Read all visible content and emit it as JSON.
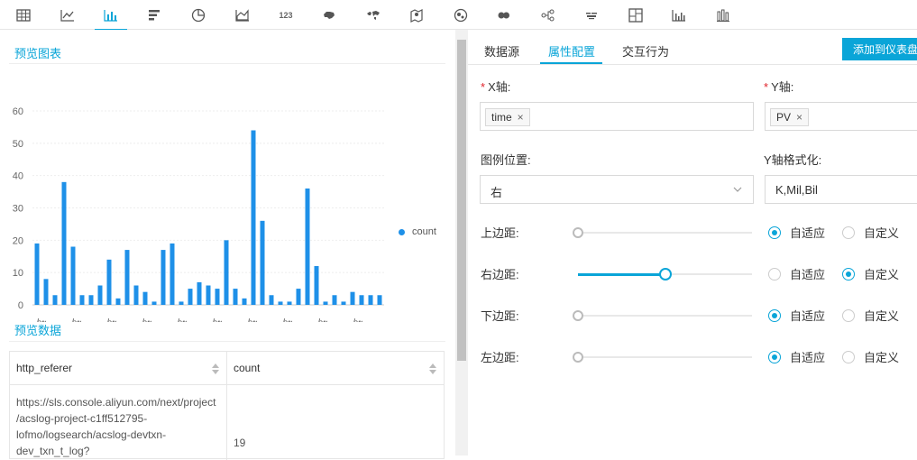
{
  "toolbar": {
    "icons": [
      "table-icon",
      "line-chart-icon",
      "bar-chart-icon",
      "horizontal-bar-icon",
      "pie-chart-icon",
      "area-chart-icon",
      "number-icon",
      "china-map-icon",
      "world-map-icon",
      "map-pin-icon",
      "flow-chart-icon",
      "scatter-map-icon",
      "tree-icon",
      "word-cloud-icon",
      "treemap-icon",
      "column-chart-icon",
      "stacked-bar-icon"
    ],
    "number_label": "123",
    "active_index": 2,
    "accent": "#0aa5d8"
  },
  "preview_chart": {
    "title": "预览图表",
    "legend": "count"
  },
  "chart_data": {
    "type": "bar",
    "categories": [
      "https...t884f",
      "https..duct=..39183",
      "https..duct=..4dakz",
      "https...logs",
      "https...s-app",
      "https...ce%22",
      "https...nq1rr",
      "https...12652",
      "https...duct=..nship",
      "https...scan"
    ],
    "values": [
      19,
      8,
      3,
      38,
      18,
      3,
      3,
      6,
      14,
      2,
      17,
      6,
      4,
      1,
      17,
      19,
      1,
      5,
      7,
      6,
      5,
      20,
      5,
      2,
      54,
      26,
      3,
      1,
      1,
      5,
      36,
      12,
      1,
      3,
      1,
      4,
      3,
      3,
      3
    ],
    "series": [
      {
        "name": "count"
      }
    ],
    "xlabel": "",
    "ylabel": "",
    "ylim": [
      0,
      60
    ],
    "yticks": [
      "0",
      "10",
      "20",
      "30",
      "40",
      "50",
      "60"
    ],
    "grid": true,
    "legend_position": "right",
    "bar_color": "#1e90e8"
  },
  "preview_data": {
    "title": "预览数据",
    "columns": [
      "http_referer",
      "count"
    ],
    "row": {
      "referer": [
        "https://sls.console.aliyun.com/next/project",
        "/acslog-project-c1ff512795-",
        "lofmo/logsearch/acslog-devtxn-",
        "dev_txn_t_log?"
      ],
      "count": "19"
    }
  },
  "config": {
    "tabs": [
      "数据源",
      "属性配置",
      "交互行为"
    ],
    "active_tab": 1,
    "add_button": "添加到仪表盘",
    "x_axis_label": "X轴:",
    "x_axis_tag": "time",
    "y_axis_label": "Y轴:",
    "y_axis_tag": "PV",
    "required_mark": "*",
    "tag_close": "×",
    "legend_pos_label": "图例位置:",
    "legend_pos_value": "右",
    "y_format_label": "Y轴格式化:",
    "y_format_value": "K,Mil,Bil",
    "margins": [
      {
        "label": "上边距:",
        "mode": "auto",
        "value": 0
      },
      {
        "label": "右边距:",
        "mode": "custom",
        "value": 0.5
      },
      {
        "label": "下边距:",
        "mode": "auto",
        "value": 0
      },
      {
        "label": "左边距:",
        "mode": "auto",
        "value": 0
      }
    ],
    "auto_label": "自适应",
    "custom_label": "自定义"
  }
}
